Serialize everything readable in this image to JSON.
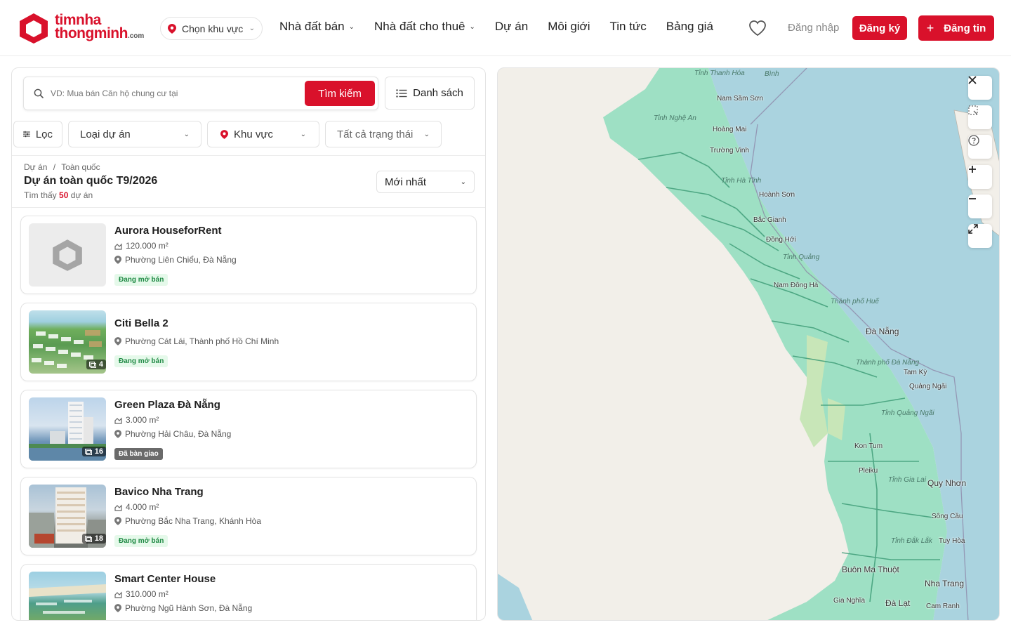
{
  "header": {
    "logo_line1": "timnha",
    "logo_line2": "thongminh",
    "logo_suffix": ".com",
    "region_label": "Chọn khu vực",
    "nav": [
      {
        "label": "Nhà đất bán",
        "dropdown": true
      },
      {
        "label": "Nhà đất cho thuê",
        "dropdown": true
      },
      {
        "label": "Dự án",
        "dropdown": false
      },
      {
        "label": "Môi giới",
        "dropdown": false
      },
      {
        "label": "Tin tức",
        "dropdown": false
      },
      {
        "label": "Bảng giá",
        "dropdown": false
      }
    ],
    "login_label": "Đăng nhập",
    "signup_label": "Đăng ký",
    "post_label": "Đăng tin",
    "accent_color": "#d9112b"
  },
  "search": {
    "placeholder": "VD: Mua bán Căn hộ chung cư tại",
    "button_label": "Tìm kiếm",
    "list_label": "Danh sách"
  },
  "filters": {
    "filter_label": "Lọc",
    "type_label": "Loại dự án",
    "area_label": "Khu vực",
    "status_label": "Tất cả trạng thái"
  },
  "results": {
    "breadcrumb_1": "Dự án",
    "breadcrumb_sep": "/",
    "breadcrumb_2": "Toàn quốc",
    "title": "Dự án toàn quốc T9/2026",
    "found_prefix": "Tìm thấy",
    "found_count": "50",
    "found_suffix": "dự án",
    "sort_label": "Mới nhất"
  },
  "projects": [
    {
      "name": "Aurora HouseforRent",
      "area": "120.000 m²",
      "location": "Phường Liên Chiểu, Đà Nẵng",
      "status": "Đang mở bán",
      "photos": ""
    },
    {
      "name": "Citi Bella 2",
      "area": "",
      "location": "Phường Cát Lái, Thành phố Hồ Chí Minh",
      "status": "Đang mở bán",
      "photos": "4"
    },
    {
      "name": "Green Plaza Đà Nẵng",
      "area": "3.000 m²",
      "location": "Phường Hải Châu, Đà Nẵng",
      "status": "Đã bàn giao",
      "photos": "16"
    },
    {
      "name": "Bavico Nha Trang",
      "area": "4.000 m²",
      "location": "Phường Bắc Nha Trang, Khánh Hòa",
      "status": "Đang mở bán",
      "photos": "18"
    },
    {
      "name": "Smart Center House",
      "area": "310.000 m²",
      "location": "Phường Ngũ Hành Sơn, Đà Nẵng",
      "status": "",
      "photos": ""
    }
  ],
  "map": {
    "cities": [
      "Nam Sầm Sơn",
      "Hoàng Mai",
      "Trường Vinh",
      "Hoành Sơn",
      "Bắc Gianh",
      "Đồng Hới",
      "Nam Đông Hà",
      "Đà Nẵng",
      "Tam Kỳ",
      "Quảng Ngãi",
      "Kon Tum",
      "Pleiku",
      "Quy Nhơn",
      "Sông Cầu",
      "Tuy Hòa",
      "Buôn Ma Thuột",
      "Nha Trang",
      "Gia Nghĩa",
      "Đà Lạt",
      "Cam Ranh"
    ],
    "provinces": [
      "Tỉnh Thanh Hóa",
      "Tỉnh Nghệ An",
      "Tỉnh Hà Tĩnh",
      "Tỉnh Quảng",
      "Thành phố Huế",
      "Thành phố Đà Nẵng",
      "Tỉnh Quảng Ngãi",
      "Tỉnh Gia Lai",
      "Tỉnh Đắk Lắk",
      "Bình"
    ],
    "land_color": "#9ee0c4",
    "sea_color": "#aad3df"
  }
}
